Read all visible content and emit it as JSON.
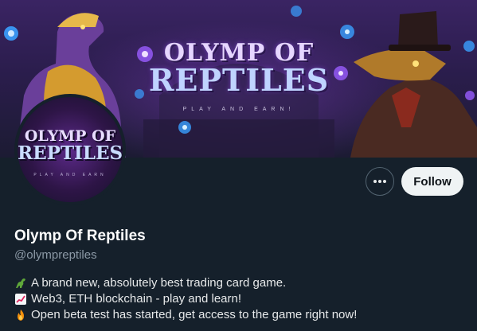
{
  "banner": {
    "title_line1": "OLYMP OF",
    "title_line2": "REPTILES",
    "subtitle": "PLAY AND EARN!"
  },
  "avatar": {
    "line1": "OLYMP OF",
    "line2": "REPTILES",
    "subtitle": "PLAY AND EARN"
  },
  "actions": {
    "more_label": "...",
    "follow_label": "Follow"
  },
  "profile": {
    "name": "Olymp Of Reptiles",
    "handle": "@olympreptiles"
  },
  "bio": [
    {
      "icon": "dinosaur-icon",
      "text": "A brand new, absolutely best trading card game."
    },
    {
      "icon": "chart-increasing-icon",
      "text": "Web3, ETH blockchain - play and learn!"
    },
    {
      "icon": "fire-icon",
      "text": "Open beta test has started, get access to the game right now!"
    }
  ],
  "colors": {
    "background": "#15202b",
    "follow_button": "#eff3f4",
    "handle_text": "#8b98a5"
  }
}
